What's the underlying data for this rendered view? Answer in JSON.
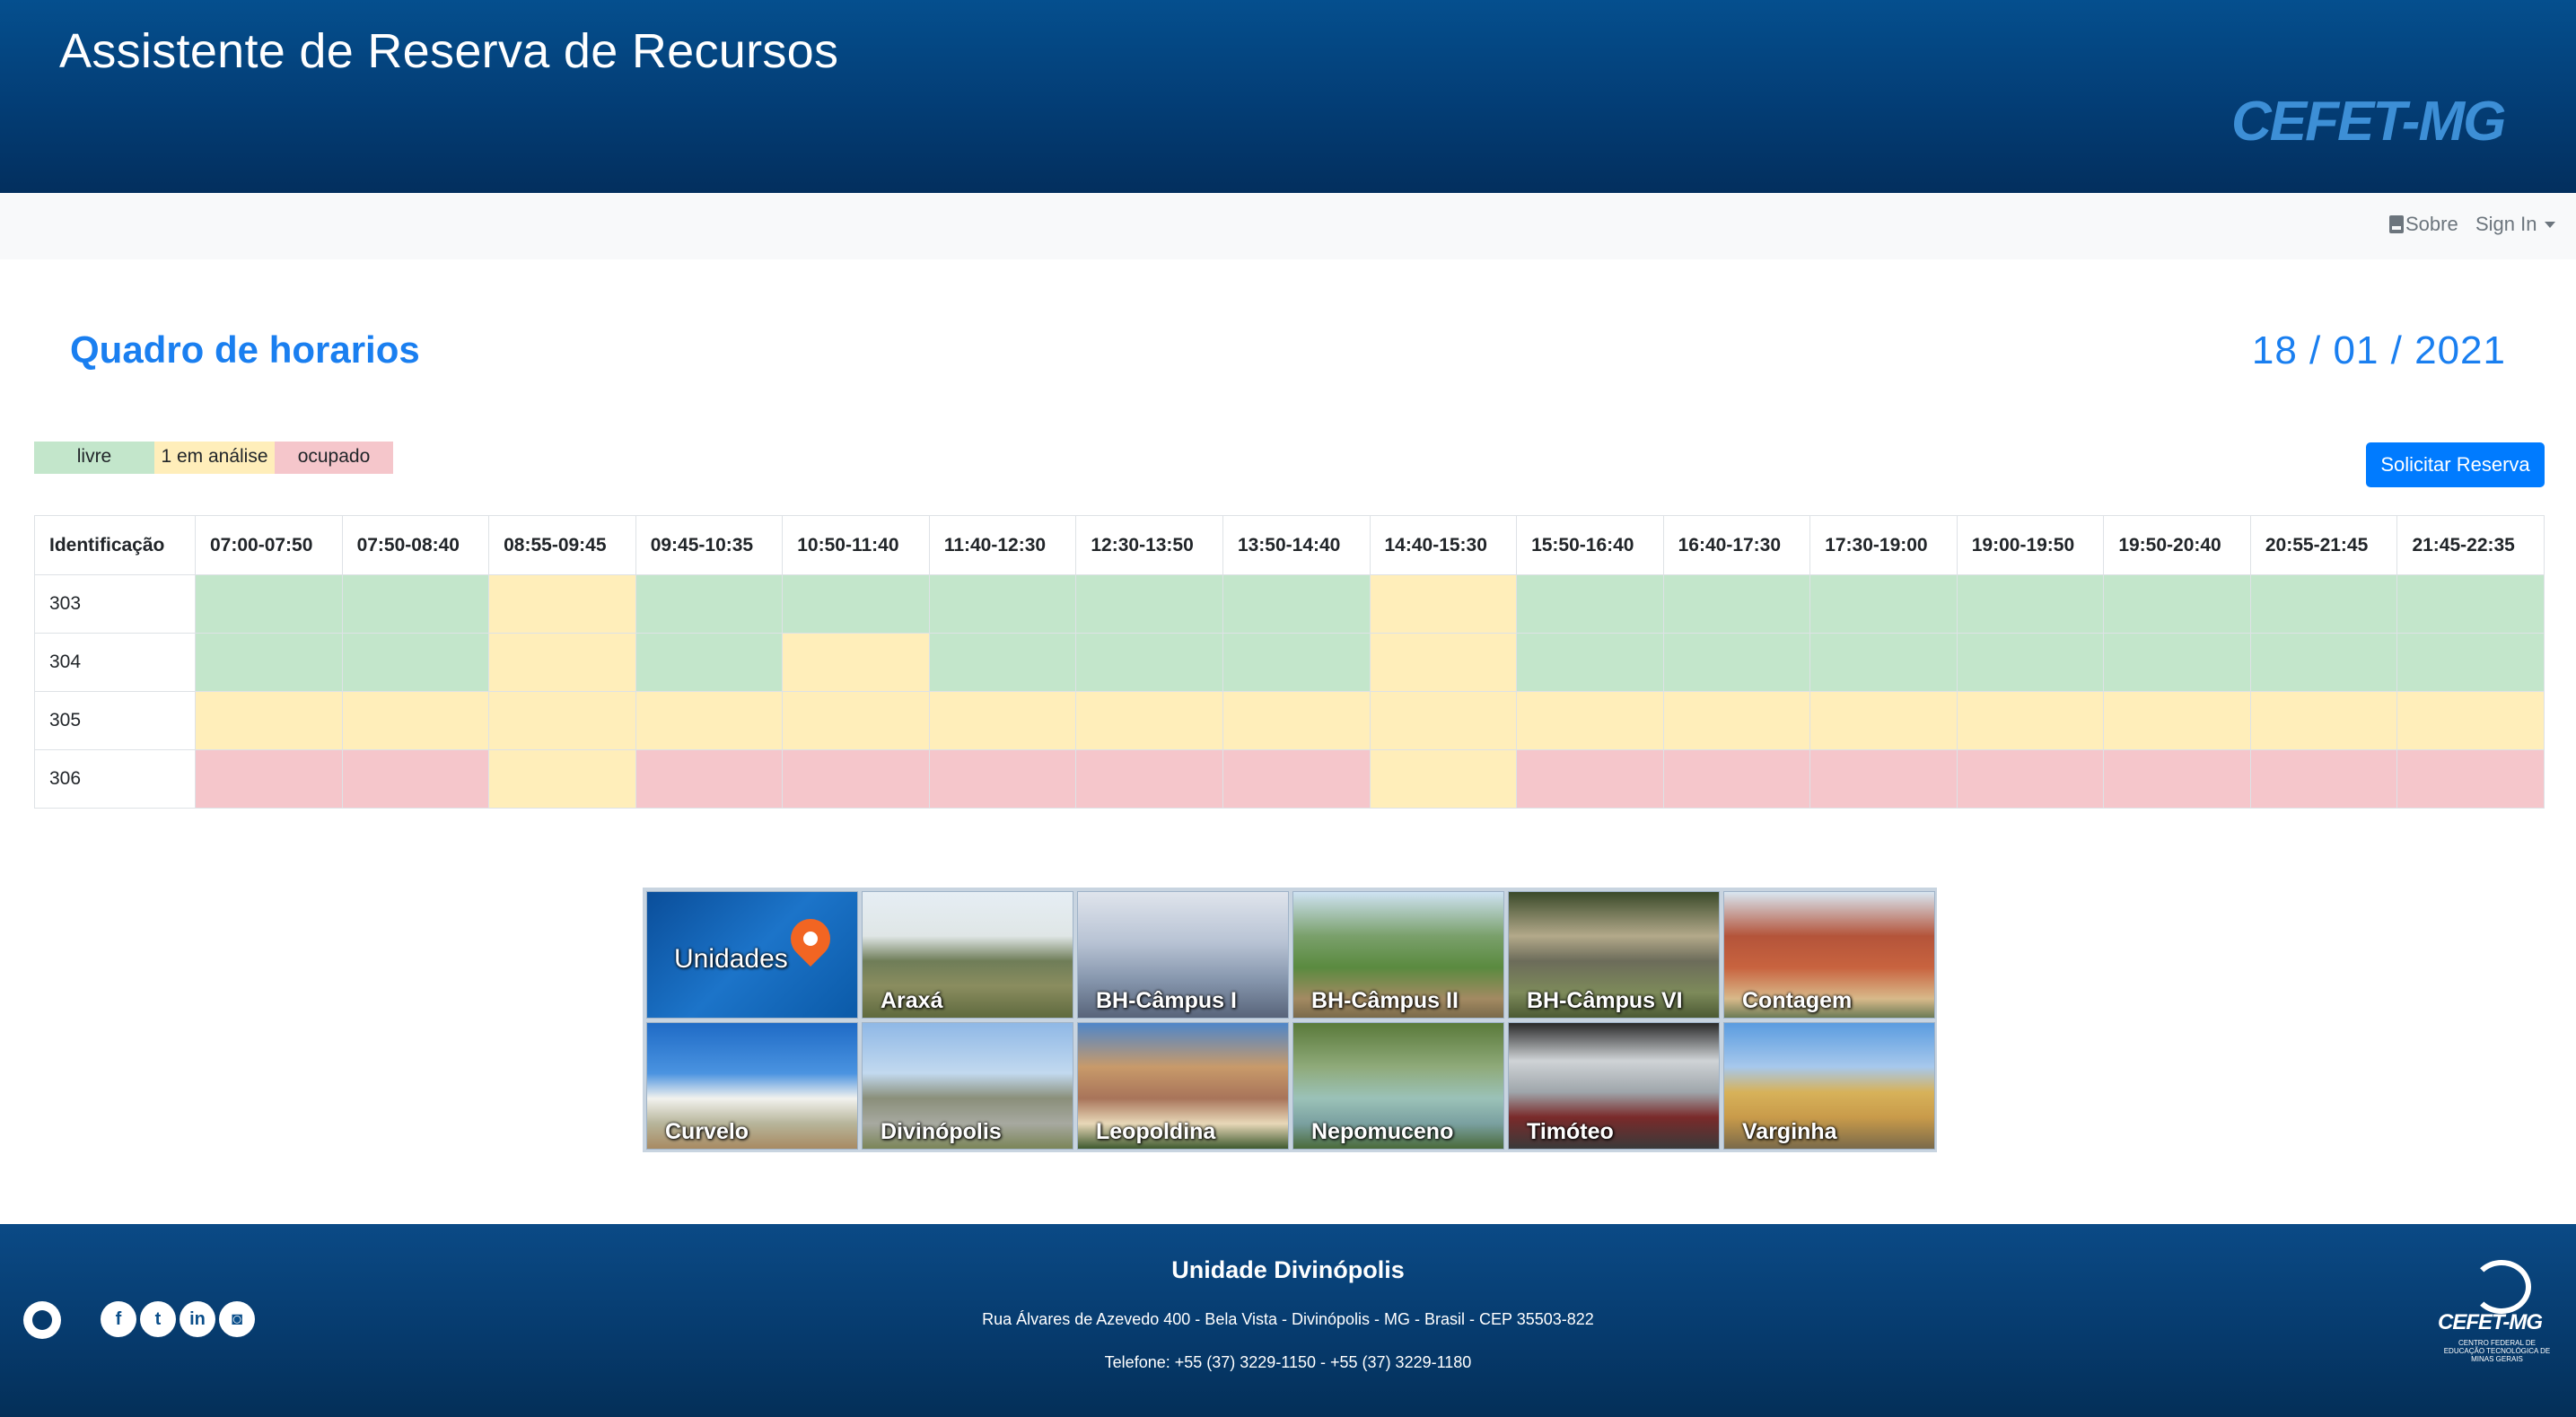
{
  "header": {
    "title": "Assistente de Reserva de Recursos",
    "logo_text": "CEFET-MG"
  },
  "navbar": {
    "about_label": "Sobre",
    "signin_label": "Sign In"
  },
  "page": {
    "title": "Quadro de horarios",
    "date": "18 / 01 / 2021"
  },
  "legend": {
    "free": "livre",
    "review": "1 em análise",
    "busy": "ocupado"
  },
  "colors": {
    "free": "#c3e6cb",
    "review": "#ffeeba",
    "busy": "#f5c6cb",
    "accent": "#007bff",
    "header": "#054f8e"
  },
  "actions": {
    "reserve_label": "Solicitar Reserva"
  },
  "table": {
    "id_header": "Identificação",
    "slots": [
      "07:00-07:50",
      "07:50-08:40",
      "08:55-09:45",
      "09:45-10:35",
      "10:50-11:40",
      "11:40-12:30",
      "12:30-13:50",
      "13:50-14:40",
      "14:40-15:30",
      "15:50-16:40",
      "16:40-17:30",
      "17:30-19:00",
      "19:00-19:50",
      "19:50-20:40",
      "20:55-21:45",
      "21:45-22:35"
    ],
    "rows": [
      {
        "id": "303",
        "status": [
          "free",
          "free",
          "review",
          "free",
          "free",
          "free",
          "free",
          "free",
          "review",
          "free",
          "free",
          "free",
          "free",
          "free",
          "free",
          "free"
        ]
      },
      {
        "id": "304",
        "status": [
          "free",
          "free",
          "review",
          "free",
          "review",
          "free",
          "free",
          "free",
          "review",
          "free",
          "free",
          "free",
          "free",
          "free",
          "free",
          "free"
        ]
      },
      {
        "id": "305",
        "status": [
          "review",
          "review",
          "review",
          "review",
          "review",
          "review",
          "review",
          "review",
          "review",
          "review",
          "review",
          "review",
          "review",
          "review",
          "review",
          "review"
        ]
      },
      {
        "id": "306",
        "status": [
          "busy",
          "busy",
          "review",
          "busy",
          "busy",
          "busy",
          "busy",
          "busy",
          "review",
          "busy",
          "busy",
          "busy",
          "busy",
          "busy",
          "busy",
          "busy"
        ]
      }
    ]
  },
  "campus": {
    "tiles": [
      {
        "label": "Unidades",
        "key": "units",
        "icon": "map-pin-icon"
      },
      {
        "label": "Araxá",
        "key": "araxa"
      },
      {
        "label": "BH-Câmpus I",
        "key": "bh1"
      },
      {
        "label": "BH-Câmpus II",
        "key": "bh2"
      },
      {
        "label": "BH-Câmpus VI",
        "key": "bh6"
      },
      {
        "label": "Contagem",
        "key": "contagem"
      },
      {
        "label": "Curvelo",
        "key": "curvelo"
      },
      {
        "label": "Divinópolis",
        "key": "divinopolis"
      },
      {
        "label": "Leopoldina",
        "key": "leopoldina"
      },
      {
        "label": "Nepomuceno",
        "key": "nepomuceno"
      },
      {
        "label": "Timóteo",
        "key": "timoteo"
      },
      {
        "label": "Varginha",
        "key": "varginha"
      }
    ]
  },
  "footer": {
    "title": "Unidade Divinópolis",
    "address": "Rua Álvares de Azevedo 400 - Bela Vista - Divinópolis - MG - Brasil - CEP 35503-822",
    "phone": "Telefone: +55 (37) 3229-1150 - +55 (37) 3229-1180",
    "logo_text": "CEFET-MG",
    "logo_subtitle": "CENTRO FEDERAL DE EDUCAÇÃO TECNOLÓGICA DE MINAS GERAIS",
    "social_icons": [
      "github-icon",
      "facebook-icon",
      "twitter-icon",
      "linkedin-icon",
      "instagram-icon"
    ]
  }
}
